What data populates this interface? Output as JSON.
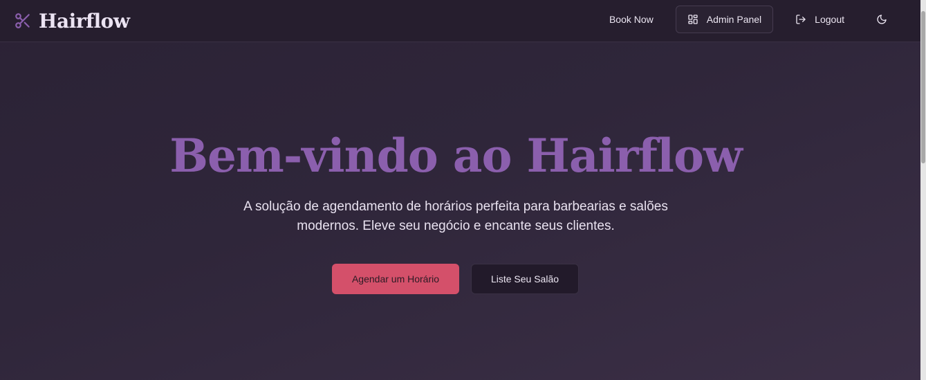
{
  "header": {
    "brand": "Hairflow",
    "brand_icon": "scissors-icon",
    "nav": {
      "book_now": "Book Now",
      "admin_panel": "Admin Panel",
      "admin_icon": "dashboard-grid-icon",
      "logout": "Logout",
      "logout_icon": "logout-icon",
      "theme_icon": "moon-icon"
    }
  },
  "hero": {
    "title": "Bem-vindo ao Hairflow",
    "subtitle": "A solução de agendamento de horários perfeita para barbearias e salões modernos. Eleve seu negócio e encante seus clientes.",
    "primary_cta": "Agendar um Horário",
    "secondary_cta": "Liste Seu Salão"
  },
  "colors": {
    "accent": "#8b5fad",
    "primary_button": "#d4506a",
    "header_bg": "#261e2e",
    "page_bg": "#2f263a"
  }
}
